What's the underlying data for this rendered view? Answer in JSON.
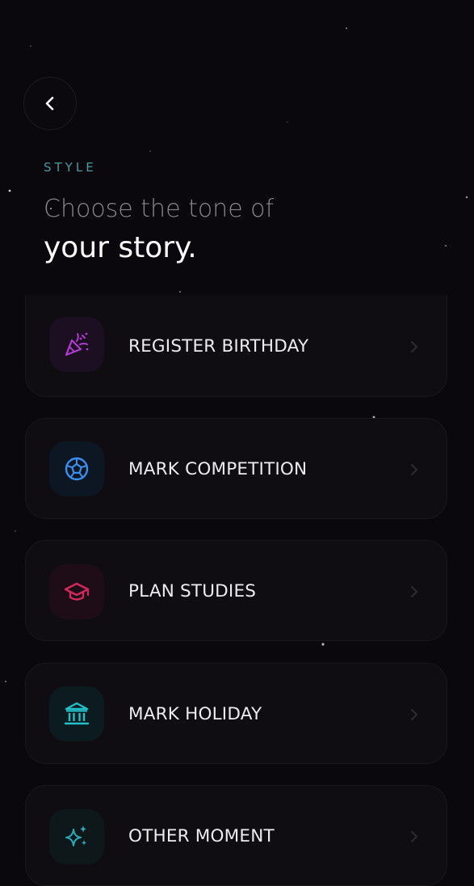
{
  "header": {
    "section_label": "STYLE",
    "title_line_1": "Choose the tone of",
    "title_line_2": "your story."
  },
  "options": [
    {
      "label": "REGISTER BIRTHDAY",
      "icon": "party-popper-icon",
      "color": "#b23ad0",
      "bg": "#1c0f22"
    },
    {
      "label": "MARK COMPETITION",
      "icon": "soccer-ball-icon",
      "color": "#3a8ff0",
      "bg": "#0d1723"
    },
    {
      "label": "PLAN STUDIES",
      "icon": "graduation-cap-icon",
      "color": "#d02a5c",
      "bg": "#1e0d16"
    },
    {
      "label": "MARK HOLIDAY",
      "icon": "landmark-icon",
      "color": "#22c0c8",
      "bg": "#0c1b1f"
    },
    {
      "label": "OTHER MOMENT",
      "icon": "sparkles-icon",
      "color": "#2aaab5",
      "bg": "#0e181b"
    }
  ]
}
